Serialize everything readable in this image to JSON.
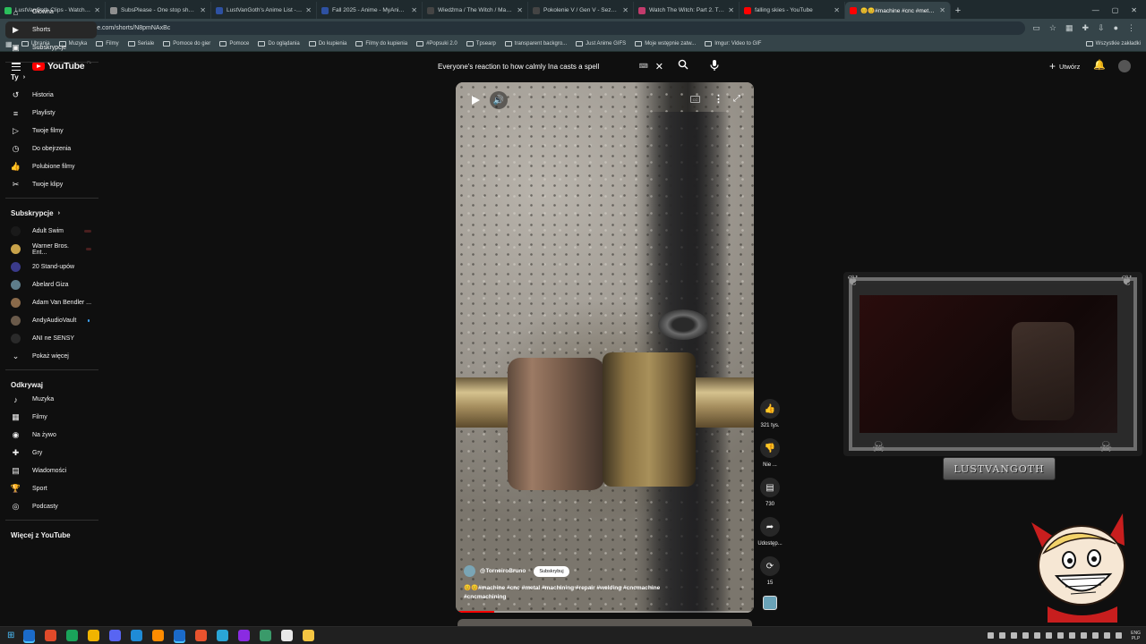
{
  "browser": {
    "tabs": [
      {
        "title": "LustVanGoth Clips - Watch Live",
        "color": "#2bbf5c"
      },
      {
        "title": "SubsPlease - One stop shop fo",
        "color": "#8f8f8f"
      },
      {
        "title": "LustVanGoth's Anime List - My",
        "color": "#2e51a2"
      },
      {
        "title": "Fall 2025 - Anime - MyAnimeLi",
        "color": "#2e51a2"
      },
      {
        "title": "Wiedźma / The Witch / Ma-nyo",
        "color": "#444444"
      },
      {
        "title": "Pokolenie V / Gen V - Sezon 2",
        "color": "#444444"
      },
      {
        "title": "Watch The Witch: Part 2. The O",
        "color": "#c23b6c"
      },
      {
        "title": "falling skies - YouTube",
        "color": "#ff0000"
      },
      {
        "title": "😊😊#machine #cnc #metal #",
        "color": "#ff0000"
      }
    ],
    "url": "youtube.com/shorts/N8pmNAxBc",
    "bookmarks": [
      "Ubrania",
      "Muzyka",
      "Filmy",
      "Seriale",
      "Pomoce do gier",
      "Pomoce",
      "Do oglądania",
      "Do kupienia",
      "Filmy do kupienia",
      "#Popsuki 2.0",
      "Tpsearp",
      "transparent backgro...",
      "Just Anime GIFS",
      "Moje wstępnie zatw...",
      "Imgur: Video to GIF"
    ],
    "bookmarks_right": "Wszystkie zakładki"
  },
  "youtube": {
    "logo": "YouTube",
    "logo_country": "PL",
    "search_query": "Everyone's reaction to how calmly Ina casts a spell",
    "create_label": "Utwórz"
  },
  "sidebar": {
    "main": [
      {
        "label": "Główna",
        "icon": "home-icon",
        "glyph": "⌂"
      },
      {
        "label": "Shorts",
        "icon": "shorts-icon",
        "glyph": "▶"
      },
      {
        "label": "Subskrypcje",
        "icon": "subscriptions-icon",
        "glyph": "▣"
      }
    ],
    "you_heading": "Ty",
    "you": [
      {
        "label": "Historia",
        "icon": "history-icon",
        "glyph": "↺"
      },
      {
        "label": "Playlisty",
        "icon": "playlists-icon",
        "glyph": "≡"
      },
      {
        "label": "Twoje filmy",
        "icon": "your-videos-icon",
        "glyph": "▷"
      },
      {
        "label": "Do obejrzenia",
        "icon": "watch-later-icon",
        "glyph": "◷"
      },
      {
        "label": "Polubione filmy",
        "icon": "liked-icon",
        "glyph": "👍"
      },
      {
        "label": "Twoje klipy",
        "icon": "clips-icon",
        "glyph": "✂"
      }
    ],
    "subs_heading": "Subskrypcje",
    "subs": [
      {
        "label": "Adult Swim",
        "color": "#1a1a1a",
        "live": true
      },
      {
        "label": "Warner Bros. Ent...",
        "color": "#c8a24a",
        "live": true
      },
      {
        "label": "20 Stand-upów",
        "color": "#3a3a8a",
        "live": false
      },
      {
        "label": "Abelard Giza",
        "color": "#5e7d8a",
        "live": false
      },
      {
        "label": "Adam Van Bendler ...",
        "color": "#8a6a4a",
        "live": false
      },
      {
        "label": "AndyAudioVault",
        "color": "#6a5a4a",
        "dot": true
      },
      {
        "label": "ANI ne SENSY",
        "color": "#2a2a2a",
        "live": false
      }
    ],
    "show_more": "Pokaż więcej",
    "explore_heading": "Odkrywaj",
    "explore": [
      {
        "label": "Muzyka",
        "icon": "music-icon",
        "glyph": "♪"
      },
      {
        "label": "Filmy",
        "icon": "movies-icon",
        "glyph": "▦"
      },
      {
        "label": "Na żywo",
        "icon": "live-icon",
        "glyph": "◉"
      },
      {
        "label": "Gry",
        "icon": "gaming-icon",
        "glyph": "✚"
      },
      {
        "label": "Wiadomości",
        "icon": "news-icon",
        "glyph": "▤"
      },
      {
        "label": "Sport",
        "icon": "sport-icon",
        "glyph": "🏆"
      },
      {
        "label": "Podcasty",
        "icon": "podcasts-icon",
        "glyph": "◎"
      }
    ],
    "more_heading": "Więcej z YouTube"
  },
  "short": {
    "channel": "@TorneiroBruno",
    "subscribe": "Subskrybuj",
    "tags_line1": "😊😊#machine #cnc #metal #machining #repair #welding #cncmachine",
    "tags_line2": "#cncmachining",
    "progress": 0.13
  },
  "actions": {
    "likes": "321 tys.",
    "dislike": "Nie ...",
    "comments": "730",
    "share": "Udostęp...",
    "remix": "15"
  },
  "overlay": {
    "nameplate": "LUSTVANGOTH"
  },
  "taskbar": {
    "icons": [
      "#1b6ac9",
      "#e04a2a",
      "#1aa35a",
      "#f0b400",
      "#5865f2",
      "#1f8bd6",
      "#ff8c00",
      "#1b6ac9",
      "#e8532e",
      "#2aa5d6",
      "#8a2be2",
      "#3a9a6a",
      "#e8e8e8",
      "#f5c542"
    ],
    "lang_top": "ENG",
    "lang_bottom": "PLP"
  }
}
